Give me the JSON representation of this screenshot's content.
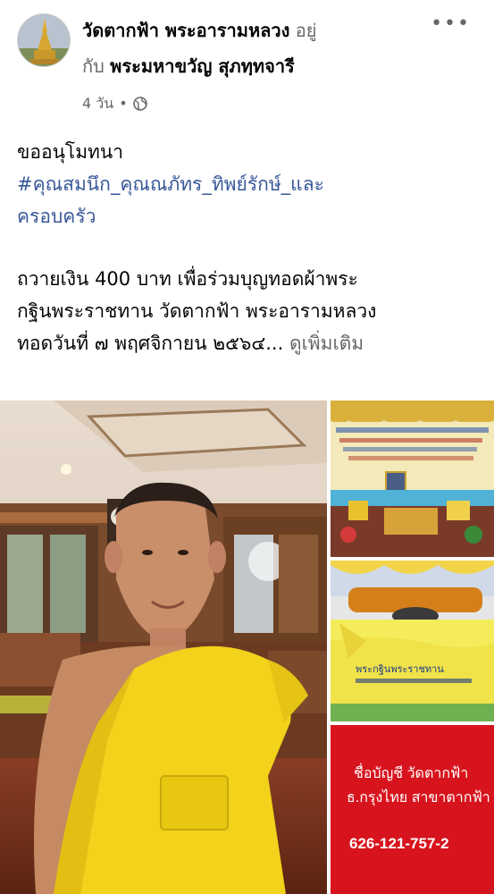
{
  "post": {
    "page_name": "วัดตากฟ้า พระอารามหลวง",
    "with_text_1": "อยู่",
    "with_text_2": "กับ",
    "tagged_name": "พระมหาขวัญ สุภทฺทจารี",
    "time": "4 วัน",
    "separator": "•",
    "privacy_icon": "globe-icon",
    "more_icon": "more-options-icon",
    "more_label": "•••",
    "body": {
      "line1": "ขออนุโมทนา",
      "hashtag_line1": "#คุณสมนึก_คุณณภัทร_ทิพย์รักษ์_และ",
      "hashtag_line2": "ครอบครัว",
      "line3": "ถวายเงิน 400 บาท เพื่อร่วมบุญทอดผ้าพระ",
      "line4": "กฐินพระราชทาน วัดตากฟ้า พระอารามหลวง",
      "line5": "ทอดวันที่ ๗ พฤศจิกายน ๒๕๖๔...",
      "see_more": "ดูเพิ่มเติม"
    }
  },
  "photos": {
    "bank_name_line": "ชื่อบัญชี วัดตากฟ้า",
    "bank_branch_line": "ธ.กรุงไทย สาขาตากฟ้า",
    "bank_account": "626-121-757-2",
    "banner_caption": "พระกฐินพระราชทาน"
  },
  "colors": {
    "hashtag": "#385898",
    "muted": "#65676b",
    "robe": "#f2d21a",
    "bank_bg": "#d7141d"
  }
}
